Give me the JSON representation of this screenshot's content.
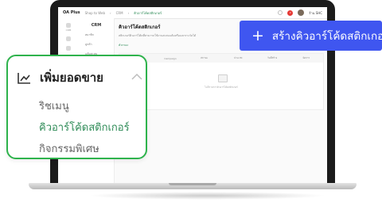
{
  "app": {
    "brand": "OA Plus",
    "breadcrumbs": [
      "Shop to Web",
      "CRM",
      "คิวอาร์โค้ดสติกเกอร์"
    ],
    "user_name": "ร้าน SHC",
    "notification_count": "2"
  },
  "sidebar": {
    "section": "CRM",
    "app_label": "CRM",
    "items": [
      "สมาชิก",
      "ลูกค้า",
      "แต้มสะสม"
    ]
  },
  "main": {
    "title": "คิวอาร์โค้ดสติกเกอร์",
    "description": "สติกเกอร์คิวอาร์โค้ดที่สามารถใช้งานสะสมแต้มหรือแลกรางวัลได้",
    "filter_label": "ตัวกรอง",
    "table_headers": [
      "ชื่อ",
      "Campaign",
      "สถานะ",
      "ประเภท",
      "วันที่สร้าง",
      "จัดการ"
    ],
    "empty_text": "ไม่มีรายการคิวอาร์โค้ดสติกเกอร์"
  },
  "create_button": {
    "label": "สร้างคิวอาร์โค้ดสติกเกอร์"
  },
  "menu": {
    "heading": "เพิ่มยอดขาย",
    "items": [
      {
        "label": "ริชเมนู",
        "active": false
      },
      {
        "label": "คิวอาร์โค้ดสติกเกอร์",
        "active": true
      },
      {
        "label": "กิจกรรมพิเศษ",
        "active": false
      }
    ]
  },
  "colors": {
    "accent": "#3f56f0",
    "green": "#2eb34c",
    "active_text": "#2e8b57"
  }
}
